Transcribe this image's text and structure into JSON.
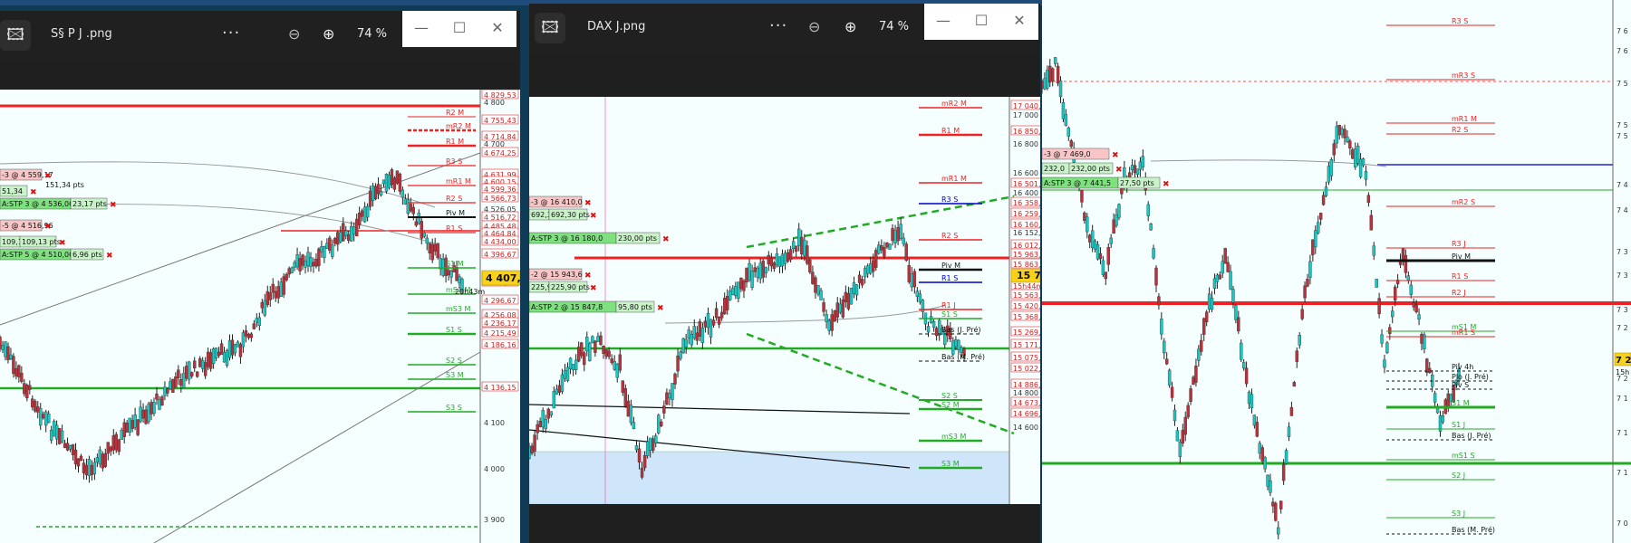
{
  "windows": [
    {
      "title": "S§ P J .png",
      "zoom": "74 %",
      "more": "···",
      "chart": {
        "price_labels": [
          "4 829,53",
          "4 800",
          "4 755,43",
          "4 714,84",
          "4 700",
          "4 674,25",
          "4 631,99",
          "4 600,15",
          "4 599,36",
          "4 566,73",
          "4 526,05",
          "4 516,72",
          "4 485,48",
          "4 464,84",
          "4 434,00",
          "4 396,67",
          "4 340,96",
          "4 321,60",
          "4 296,67",
          "4 256,08",
          "4 236,17",
          "4 215,49",
          "4 186,16",
          "4 136,15",
          "4 100",
          "4 000",
          "3 900"
        ],
        "levels": [
          "R2 M",
          "mR2 M",
          "R1 M",
          "R3 S",
          "mR1 M",
          "R2 S",
          "Piv M",
          "R1 S",
          "S1 M",
          "mS1 M",
          "S1 S",
          "S2 S",
          "S3 M",
          "S3 S",
          "mS3 M"
        ],
        "orders": [
          "-3 @ 4 559,17",
          "51,34",
          "151,34 pts",
          "A:STP 3 @ 4 536,00",
          "23,17 pts",
          "-5 @ 4 516,96",
          "109,13",
          "109,13 pts",
          "A:STP 5 @ 4 510,00",
          "6,96 pts"
        ],
        "last_price": "4 407,5",
        "timer": "20h43m"
      }
    },
    {
      "title": "DAX J.png",
      "zoom": "74 %",
      "more": "···",
      "chart": {
        "price_labels": [
          "17 040,2",
          "17 000",
          "16 850,6",
          "16 800",
          "16 600",
          "16 501,7",
          "16 400",
          "16 358,4",
          "16 259,6",
          "16 160,8",
          "16 152,8",
          "16 012,2",
          "15 963,2",
          "15 863,5",
          "15 717",
          "15h44m",
          "15 563,3",
          "15 420,0",
          "15 368,6",
          "15 269,8",
          "15 171,0",
          "15 075,8",
          "15 022,4",
          "14 886,2",
          "14 800",
          "14 673,7",
          "14 696,6",
          "14 600"
        ],
        "levels": [
          "mR2 M",
          "R1 M",
          "mR1 M",
          "R3 S",
          "R2 S",
          "R1 S",
          "Piv M",
          "R1 J",
          "S1 S",
          "Bas (J. Pré)",
          "Bas (M. Pré)",
          "S2 S",
          "S2 M",
          "mS3 M",
          "S3 M"
        ],
        "orders": [
          "-3 @ 16 410,0",
          "692,3",
          "692,30 pts",
          "A:STP 3 @ 16 180,0",
          "230,00 pts",
          "-2 @ 15 943,6",
          "225,9",
          "225,90 pts",
          "A:STP 2 @ 15 847,8",
          "95,80 pts"
        ],
        "last_price": "15 717",
        "timer": "15h44m"
      }
    },
    {
      "chart": {
        "price_labels": [
          "7 6",
          "7 6",
          "7 5",
          "7 5",
          "7 5",
          "7 4",
          "7 4",
          "7 3",
          "7 3",
          "7 3",
          "7 2",
          "7 2",
          "7 2",
          "7 1",
          "7 1",
          "7 1",
          "7 0"
        ],
        "levels": [
          "R3 S",
          "mR3 S",
          "mR1 M",
          "R2 S",
          "mR2 S",
          "R3 J",
          "Piv M",
          "R1 S",
          "R2 J",
          "mS1 M",
          "mR1 S",
          "Piv 4h",
          "Plo (J. Pré)",
          "Piv S",
          "S1 M",
          "S1 J",
          "Bas (J. Pré)",
          "mS1 S",
          "S2 J",
          "S3 J",
          "Bas (M. Pré)"
        ],
        "orders": [
          "-3 @ 7 469,0",
          "232,0",
          "232,00 pts",
          "A:STP 3 @ 7 441,5",
          "27,50 pts"
        ],
        "last_price": "7 2",
        "timer": "15h"
      }
    }
  ]
}
